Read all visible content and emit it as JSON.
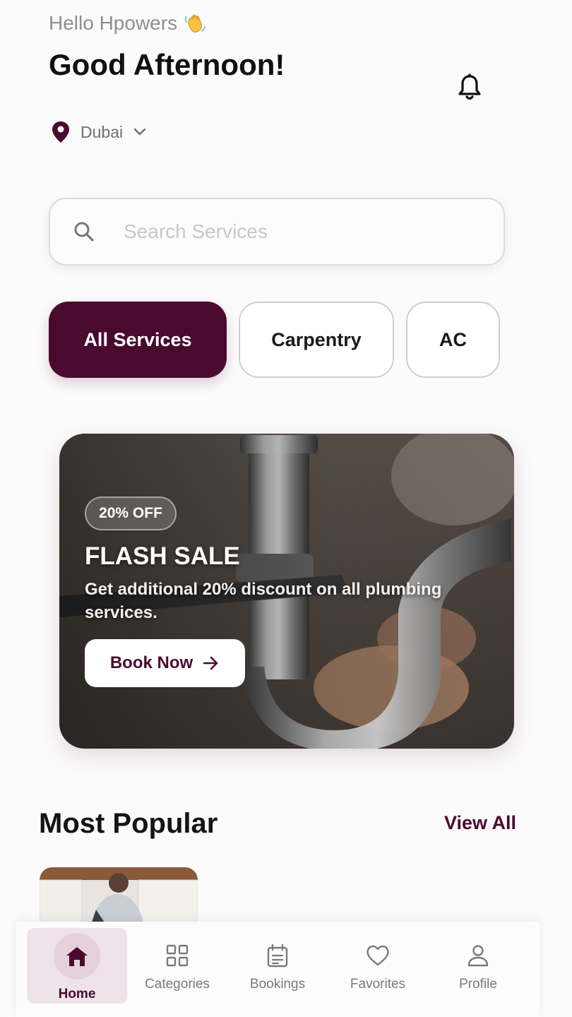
{
  "header": {
    "greeting": "Hello Hpowers",
    "greeting_icon": "waving-hand-icon",
    "title": "Good Afternoon!",
    "notification_icon": "bell-icon"
  },
  "location": {
    "icon": "map-pin-icon",
    "label": "Dubai",
    "dropdown_icon": "chevron-down-icon"
  },
  "search": {
    "icon": "search-icon",
    "placeholder": "Search Services",
    "value": ""
  },
  "chips": [
    "All Services",
    "Carpentry",
    "AC"
  ],
  "banner": {
    "badge": "20% OFF",
    "title": "FLASH SALE",
    "description": "Get additional 20% discount on all plumbing services.",
    "button_label": "Book Now",
    "button_icon": "arrow-right-icon"
  },
  "popular": {
    "heading": "Most Popular",
    "view_all": "View All"
  },
  "nav": [
    {
      "label": "Home",
      "icon": "home-icon",
      "active": true
    },
    {
      "label": "Categories",
      "icon": "grid-icon"
    },
    {
      "label": "Bookings",
      "icon": "calendar-icon"
    },
    {
      "label": "Favorites",
      "icon": "heart-icon"
    },
    {
      "label": "Profile",
      "icon": "user-icon"
    }
  ],
  "colors": {
    "primary": "#4a0a30",
    "background": "#fcfbfb",
    "nav_active_bg": "#efe3ea"
  }
}
